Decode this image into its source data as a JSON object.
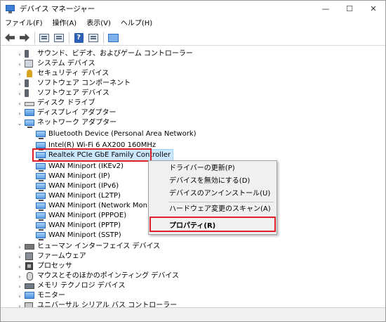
{
  "window": {
    "title": "デバイス マネージャー",
    "controls": {
      "minimize": "—",
      "maximize": "☐",
      "close": "✕"
    }
  },
  "menubar": {
    "items": [
      "ファイル(F)",
      "操作(A)",
      "表示(V)",
      "ヘルプ(H)"
    ]
  },
  "toolbar": {
    "buttons": [
      "back-icon",
      "forward-icon",
      "properties-icon",
      "update-icon",
      "help-icon",
      "view-icon",
      "monitor-icon"
    ],
    "help_glyph": "?"
  },
  "tree": {
    "categories_top": [
      {
        "label": "サウンド、ビデオ、およびゲーム コントローラー",
        "icon": "speaker-icon"
      },
      {
        "label": "システム デバイス",
        "icon": "system-device-icon"
      },
      {
        "label": "セキュリティ デバイス",
        "icon": "security-device-icon"
      },
      {
        "label": "ソフトウェア コンポーネント",
        "icon": "software-component-icon"
      },
      {
        "label": "ソフトウェア デバイス",
        "icon": "software-device-icon"
      },
      {
        "label": "ディスク ドライブ",
        "icon": "disk-drive-icon"
      },
      {
        "label": "ディスプレイ アダプター",
        "icon": "display-adapter-icon"
      },
      {
        "label": "ネットワーク アダプター",
        "icon": "network-adapter-icon",
        "expanded": true
      }
    ],
    "network_children": [
      "Bluetooth Device (Personal Area Network)",
      "Intel(R) Wi-Fi 6 AX200 160MHz",
      "Realtek PCIe GbE Family Controller",
      "WAN Miniport (IKEv2)",
      "WAN Miniport (IP)",
      "WAN Miniport (IPv6)",
      "WAN Miniport (L2TP)",
      "WAN Miniport (Network Monitor)",
      "WAN Miniport (PPPOE)",
      "WAN Miniport (PPTP)",
      "WAN Miniport (SSTP)"
    ],
    "selected_child": "Realtek PCIe GbE Family Controller",
    "categories_bottom": [
      {
        "label": "ヒューマン インターフェイス デバイス",
        "icon": "hid-icon"
      },
      {
        "label": "ファームウェア",
        "icon": "firmware-icon"
      },
      {
        "label": "プロセッサ",
        "icon": "processor-icon"
      },
      {
        "label": "マウスとそのほかのポインティング デバイス",
        "icon": "mouse-icon"
      },
      {
        "label": "メモリ テクノロジ デバイス",
        "icon": "memory-icon"
      },
      {
        "label": "モニター",
        "icon": "monitor-icon"
      },
      {
        "label": "ユニバーサル シリアル バス コントローラー",
        "icon": "usb-icon"
      }
    ]
  },
  "context_menu": {
    "items": [
      {
        "label": "ドライバーの更新(P)"
      },
      {
        "label": "デバイスを無効にする(D)"
      },
      {
        "label": "デバイスのアンインストール(U)"
      },
      {
        "label": "ハードウェア変更のスキャン(A)"
      },
      {
        "label": "プロパティ(R)",
        "bold": true
      }
    ]
  },
  "highlight_color": "#e0202a"
}
